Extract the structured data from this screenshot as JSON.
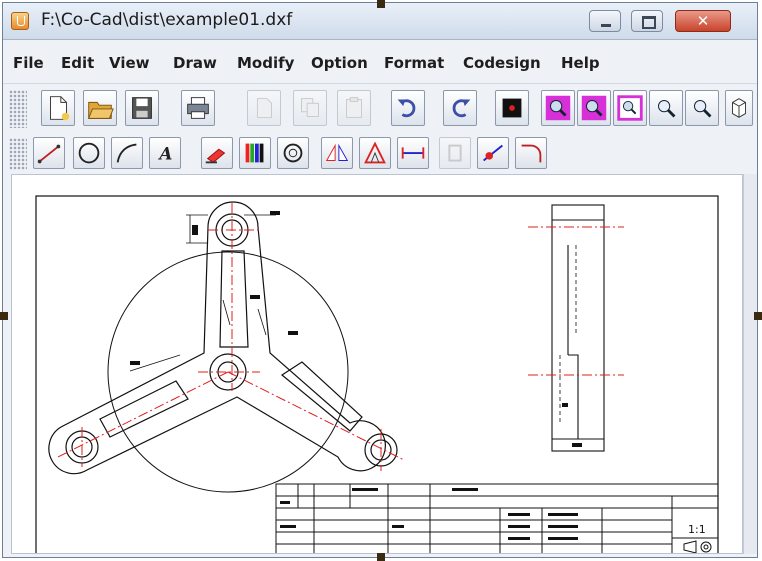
{
  "window": {
    "title": "F:\\Co-Cad\\dist\\example01.dxf",
    "controls": {
      "minimize_icon": "minimize-icon",
      "maximize_icon": "maximize-icon",
      "close_glyph": "✕"
    }
  },
  "menubar": {
    "items": [
      "File",
      "Edit",
      "View",
      "Draw",
      "Modify",
      "Option",
      "Format",
      "Codesign",
      "Help"
    ]
  },
  "toolbar_main": {
    "buttons": [
      {
        "icon": "new-file-icon",
        "enabled": true
      },
      {
        "icon": "open-folder-icon",
        "enabled": true
      },
      {
        "icon": "save-icon",
        "enabled": true
      },
      {
        "icon": "print-icon",
        "enabled": true
      },
      {
        "icon": "cut-icon",
        "enabled": false
      },
      {
        "icon": "copy-icon",
        "enabled": false
      },
      {
        "icon": "paste-icon",
        "enabled": false
      },
      {
        "icon": "undo-icon",
        "enabled": true
      },
      {
        "icon": "redo-icon",
        "enabled": true
      },
      {
        "icon": "redraw-icon",
        "enabled": true
      },
      {
        "icon": "zoom-in-icon",
        "enabled": true
      },
      {
        "icon": "zoom-out-icon",
        "enabled": true
      },
      {
        "icon": "zoom-window-icon",
        "enabled": true
      },
      {
        "icon": "zoom-all-icon",
        "enabled": true
      },
      {
        "icon": "zoom-previous-icon",
        "enabled": true
      },
      {
        "icon": "properties-icon",
        "enabled": true
      }
    ]
  },
  "toolbar_draw": {
    "buttons": [
      {
        "icon": "line-icon",
        "enabled": true
      },
      {
        "icon": "circle-icon",
        "enabled": true
      },
      {
        "icon": "arc-icon",
        "enabled": true
      },
      {
        "icon": "text-icon",
        "label": "A",
        "enabled": true
      },
      {
        "icon": "erase-icon",
        "enabled": true
      },
      {
        "icon": "layer-color-icon",
        "enabled": true
      },
      {
        "icon": "hatch-icon",
        "enabled": true
      },
      {
        "icon": "mirror-icon",
        "enabled": true
      },
      {
        "icon": "scale-icon",
        "enabled": true
      },
      {
        "icon": "dimension-icon",
        "enabled": true
      },
      {
        "icon": "offset-icon",
        "enabled": false
      },
      {
        "icon": "trim-icon",
        "enabled": true
      },
      {
        "icon": "fillet-icon",
        "enabled": true
      }
    ]
  },
  "drawing": {
    "title_block": {
      "scale": "1:1",
      "projection_symbol": "projection-symbol-icon"
    },
    "colors": {
      "outline": "#111111",
      "centerline": "#e0201c",
      "dimension": "#111111"
    }
  },
  "colors": {
    "titlebar": "#dbe5f1",
    "close_button": "#d4553d",
    "toolbar_bg": "#eef1f5"
  }
}
